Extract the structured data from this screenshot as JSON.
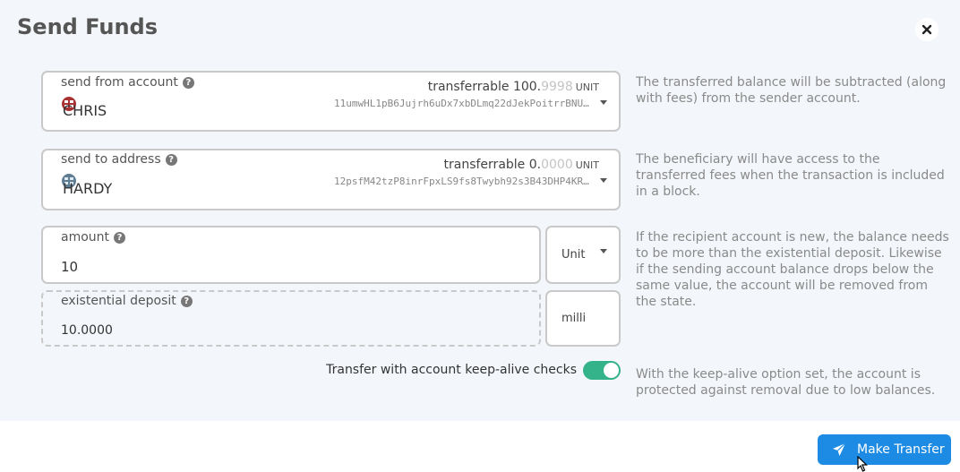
{
  "modal": {
    "title": "Send Funds",
    "close_icon": "close-icon"
  },
  "send_from": {
    "label": "send from account",
    "transferrable_label": "transferrable",
    "balance_int": "100.",
    "balance_dec": "9998",
    "unit": "UNIT",
    "account_name": "CHRIS",
    "address": "11umwHL1pB6Jujrh6uDx7xbDLmq22dJekPoitrrBNUNyBNgj",
    "help": "The transferred balance will be subtracted (along with fees) from the sender account."
  },
  "send_to": {
    "label": "send to address",
    "transferrable_label": "transferrable",
    "balance_int": "0.",
    "balance_dec": "0000",
    "unit": "UNIT",
    "account_name": "HARDY",
    "address": "12psfM42tzP8inrFpxLS9fs8Twybh92s3B43DHP4KRKoWp3",
    "help": "The beneficiary will have access to the transferred fees when the transaction is included in a block."
  },
  "amount": {
    "label": "amount",
    "value": "10",
    "unit_option": "Unit",
    "help": "If the recipient account is new, the balance needs to be more than the existential deposit. Likewise if the sending account balance drops below the same value, the account will be removed from the state."
  },
  "existential_deposit": {
    "label": "existential deposit",
    "value": "10.0000",
    "unit": "milli"
  },
  "keep_alive": {
    "label": "Transfer with account keep-alive checks",
    "enabled": true,
    "help": "With the keep-alive option set, the account is protected against removal due to low balances."
  },
  "actions": {
    "submit_label": "Make Transfer",
    "submit_icon": "paper-plane-icon"
  },
  "colors": {
    "accent": "#1d8be3",
    "toggle_on": "#34b38a",
    "background": "#f3f6fa"
  }
}
